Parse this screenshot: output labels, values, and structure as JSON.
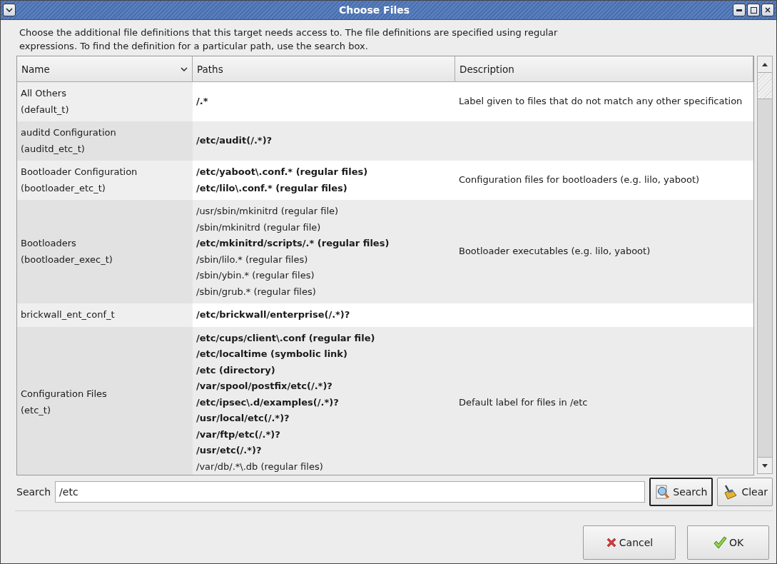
{
  "window": {
    "title": "Choose Files"
  },
  "intro": "Choose the additional file definitions that this target needs access to. The file definitions are specified using regular expressions.  To find the definition for a particular path, use the search box.",
  "table": {
    "columns": [
      {
        "label": "Name",
        "sortable": true
      },
      {
        "label": "Paths",
        "sortable": false
      },
      {
        "label": "Description",
        "sortable": false
      }
    ],
    "rows": [
      {
        "name": [
          "All Others",
          "(default_t)"
        ],
        "paths": [
          {
            "text": "/.*",
            "bold": true
          }
        ],
        "description": "Label given to files that do not match any other specification"
      },
      {
        "name": [
          "auditd Configuration",
          "(auditd_etc_t)"
        ],
        "paths": [
          {
            "text": "/etc/audit(/.*)?",
            "bold": true
          }
        ],
        "description": ""
      },
      {
        "name": [
          "Bootloader Configuration",
          "(bootloader_etc_t)"
        ],
        "paths": [
          {
            "text": "/etc/yaboot\\.conf.* (regular files)",
            "bold": true
          },
          {
            "text": "/etc/lilo\\.conf.* (regular files)",
            "bold": true
          }
        ],
        "description": "Configuration files for bootloaders (e.g. lilo, yaboot)"
      },
      {
        "name": [
          "Bootloaders",
          "(bootloader_exec_t)"
        ],
        "paths": [
          {
            "text": "/usr/sbin/mkinitrd (regular file)",
            "bold": false
          },
          {
            "text": "/sbin/mkinitrd (regular file)",
            "bold": false
          },
          {
            "text": "/etc/mkinitrd/scripts/.* (regular files)",
            "bold": true
          },
          {
            "text": "/sbin/lilo.* (regular files)",
            "bold": false
          },
          {
            "text": "/sbin/ybin.* (regular files)",
            "bold": false
          },
          {
            "text": "/sbin/grub.* (regular files)",
            "bold": false
          }
        ],
        "description": "Bootloader executables (e.g. lilo, yaboot)"
      },
      {
        "name": [
          "brickwall_ent_conf_t"
        ],
        "paths": [
          {
            "text": "/etc/brickwall/enterprise(/.*)?",
            "bold": true
          }
        ],
        "description": ""
      },
      {
        "name": [
          "Configuration Files",
          "(etc_t)"
        ],
        "paths": [
          {
            "text": "/etc/cups/client\\.conf (regular file)",
            "bold": true
          },
          {
            "text": "/etc/localtime (symbolic link)",
            "bold": true
          },
          {
            "text": "/etc (directory)",
            "bold": true
          },
          {
            "text": "/var/spool/postfix/etc(/.*)?",
            "bold": true
          },
          {
            "text": "/etc/ipsec\\.d/examples(/.*)?",
            "bold": true
          },
          {
            "text": "/usr/local/etc(/.*)?",
            "bold": true
          },
          {
            "text": "/var/ftp/etc(/.*)?",
            "bold": true
          },
          {
            "text": "/usr/etc(/.*)?",
            "bold": true
          },
          {
            "text": "/var/db/.*\\.db (regular files)",
            "bold": false
          }
        ],
        "description": "Default label for files in /etc"
      }
    ]
  },
  "search": {
    "label": "Search",
    "value": "/etc",
    "buttons": [
      {
        "label": "Search",
        "kind": "search"
      },
      {
        "label": "Clear",
        "kind": "clear"
      }
    ]
  },
  "buttons": [
    {
      "label": "Cancel",
      "kind": "cancel"
    },
    {
      "label": "OK",
      "kind": "ok"
    }
  ]
}
